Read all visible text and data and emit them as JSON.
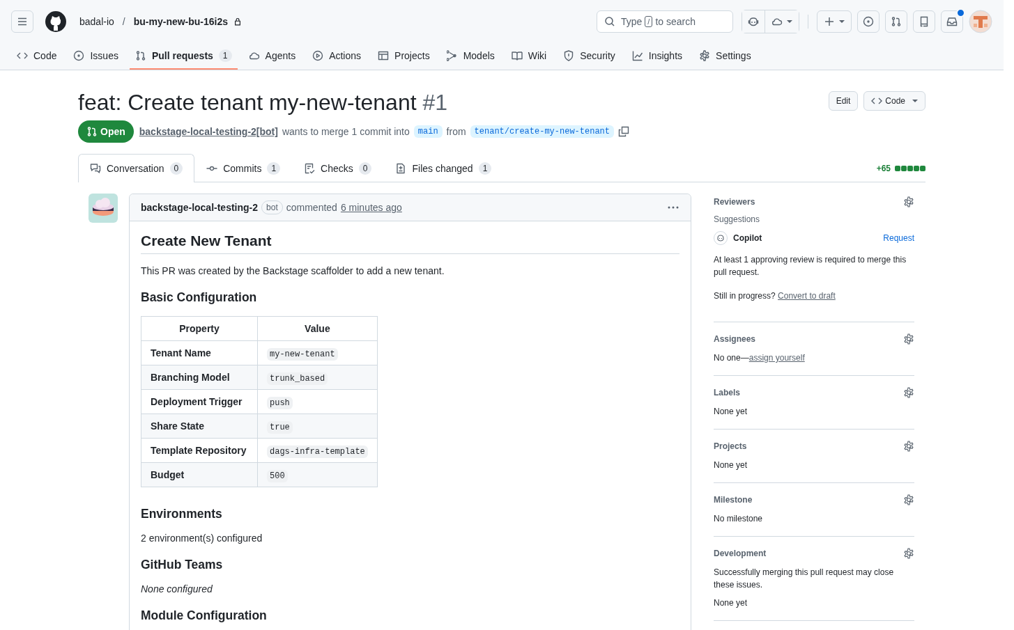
{
  "header": {
    "owner": "badal-io",
    "separator": "/",
    "repo": "bu-my-new-bu-16i2s",
    "search": {
      "before": "Type",
      "key": "/",
      "after": "to search"
    },
    "inbox_unread": true
  },
  "repo_nav": [
    {
      "label": "Code",
      "selected": false
    },
    {
      "label": "Issues",
      "selected": false
    },
    {
      "label": "Pull requests",
      "count": "1",
      "selected": true
    },
    {
      "label": "Agents",
      "selected": false
    },
    {
      "label": "Actions",
      "selected": false
    },
    {
      "label": "Projects",
      "selected": false
    },
    {
      "label": "Models",
      "selected": false
    },
    {
      "label": "Wiki",
      "selected": false
    },
    {
      "label": "Security",
      "selected": false
    },
    {
      "label": "Insights",
      "selected": false
    },
    {
      "label": "Settings",
      "selected": false
    }
  ],
  "pull_request": {
    "title": "feat: Create tenant my-new-tenant",
    "number": "#1",
    "state": "Open",
    "author": "backstage-local-testing-2[bot]",
    "merge_text": "wants to merge 1 commit into",
    "base": "main",
    "from_text": "from",
    "head": "tenant/create-my-new-tenant",
    "buttons": [
      "Edit",
      "Code"
    ]
  },
  "pr_tabs": [
    {
      "label": "Conversation",
      "count": "0",
      "selected": true
    },
    {
      "label": "Commits",
      "count": "1",
      "selected": false
    },
    {
      "label": "Checks",
      "count": "0",
      "selected": false
    },
    {
      "label": "Files changed",
      "count": "1",
      "selected": false
    }
  ],
  "diffstat": {
    "added": "+65"
  },
  "comment": {
    "author": "backstage-local-testing-2",
    "badge": "bot",
    "action": "commented",
    "time": "6 minutes ago",
    "heading": "Create New Tenant",
    "intro": "This PR was created by the Backstage scaffolder to add a new tenant.",
    "table_heading": "Basic Configuration",
    "table": {
      "columns": [
        "Property",
        "Value"
      ],
      "rows": [
        {
          "property": "Tenant Name",
          "value": "my-new-tenant"
        },
        {
          "property": "Branching Model",
          "value": "trunk_based"
        },
        {
          "property": "Deployment Trigger",
          "value": "push"
        },
        {
          "property": "Share State",
          "value": "true"
        },
        {
          "property": "Template Repository",
          "value": "dags-infra-template"
        },
        {
          "property": "Budget",
          "value": "500"
        }
      ]
    },
    "sections": [
      {
        "heading": "Environments",
        "text": "2 environment(s) configured",
        "italic": false
      },
      {
        "heading": "GitHub Teams",
        "text": "None configured",
        "italic": true
      }
    ],
    "cut_heading": "Module Configuration"
  },
  "sidebar": {
    "reviewers": {
      "title": "Reviewers",
      "suggestions": "Suggestions",
      "reviewer": "Copilot",
      "request": "Request",
      "note": "At least 1 approving review is required to merge this pull request.",
      "progress": "Still in progress?",
      "draft_link": "Convert to draft"
    },
    "sections": [
      {
        "title": "Assignees",
        "lines": [
          {
            "text": "No one—",
            "link": "assign yourself"
          }
        ]
      },
      {
        "title": "Labels",
        "lines": [
          {
            "text": "None yet"
          }
        ]
      },
      {
        "title": "Projects",
        "lines": [
          {
            "text": "None yet"
          }
        ]
      },
      {
        "title": "Milestone",
        "lines": [
          {
            "text": "No milestone"
          }
        ]
      },
      {
        "title": "Development",
        "lines": [
          {
            "text": "Successfully merging this pull request may close these issues."
          },
          {
            "text": "None yet"
          }
        ]
      }
    ]
  }
}
